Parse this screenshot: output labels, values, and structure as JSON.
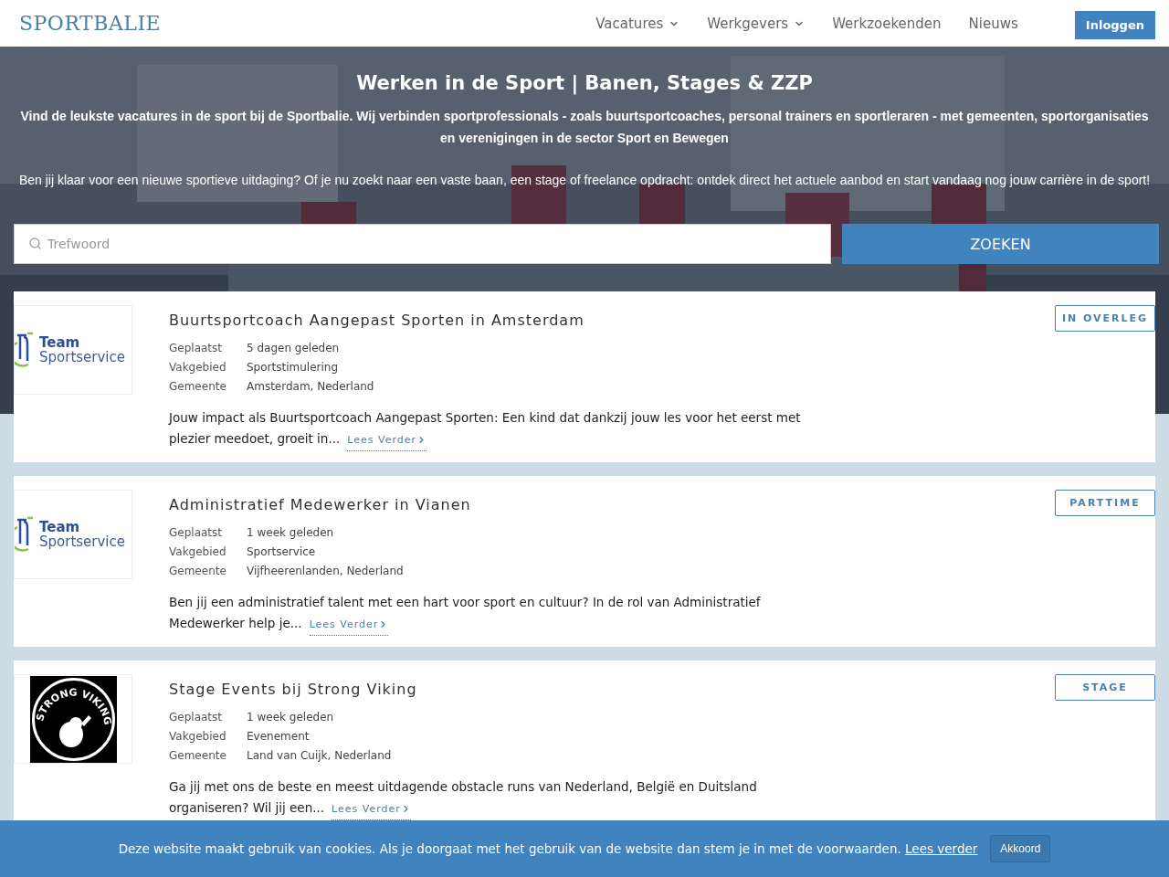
{
  "header": {
    "logo": "SPORTBALIE",
    "nav": [
      {
        "label": "Vacatures",
        "dropdown": true
      },
      {
        "label": "Werkgevers",
        "dropdown": true
      },
      {
        "label": "Werkzoekenden",
        "dropdown": false
      },
      {
        "label": "Nieuws",
        "dropdown": false
      }
    ],
    "login": "Inloggen"
  },
  "hero": {
    "title": "Werken in de Sport | Banen, Stages & ZZP",
    "subtitle": "Vind de leukste vacatures in de sport bij de Sportbalie. Wij verbinden sportprofessionals - zoals buurtsportcoaches, personal trainers en sportleraren - met gemeenten, sportorganisaties en verenigingen in de sector Sport en Bewegen",
    "text": "Ben jij klaar voor een nieuwe sportieve uitdaging? Of je nu zoekt naar een vaste baan, een stage of freelance opdracht: ontdek direct het actuele aanbod en start vandaag nog jouw carrière in de sport!"
  },
  "search": {
    "placeholder": "Trefwoord",
    "button": "ZOEKEN"
  },
  "jobs": [
    {
      "logo": {
        "kind": "team",
        "lines": [
          "Team",
          "Sportservice"
        ]
      },
      "title": "Buurtsportcoach Aangepast Sporten in Amsterdam",
      "details": [
        {
          "label": "Geplaatst",
          "value": "5 dagen geleden"
        },
        {
          "label": "Vakgebied",
          "value": "Sportstimulering"
        },
        {
          "label": "Gemeente",
          "value": "Amsterdam, Nederland"
        }
      ],
      "excerpt": "Jouw impact als Buurtsportcoach Aangepast Sporten: Een kind dat dankzij jouw les voor het eerst met plezier meedoet, groeit in...",
      "more": "Lees Verder",
      "tag": "IN OVERLEG"
    },
    {
      "logo": {
        "kind": "team",
        "lines": [
          "Team",
          "Sportservice"
        ]
      },
      "title": "Administratief Medewerker in Vianen",
      "details": [
        {
          "label": "Geplaatst",
          "value": "1 week geleden"
        },
        {
          "label": "Vakgebied",
          "value": "Sportservice"
        },
        {
          "label": "Gemeente",
          "value": "Vijfheerenlanden, Nederland"
        }
      ],
      "excerpt": "Ben jij een administratief talent met een hart voor sport en cultuur? In de rol van Administratief Medewerker help je...",
      "more": "Lees Verder",
      "tag": "PARTTIME"
    },
    {
      "logo": {
        "kind": "viking",
        "lines": [
          "STRONG VIKING"
        ]
      },
      "title": "Stage Events bij Strong Viking",
      "details": [
        {
          "label": "Geplaatst",
          "value": "1 week geleden"
        },
        {
          "label": "Vakgebied",
          "value": "Evenement"
        },
        {
          "label": "Gemeente",
          "value": "Land van Cuijk, Nederland"
        }
      ],
      "excerpt": "Ga jij met ons de beste en meest uitdagende obstacle runs van Nederland, België en Duitsland organiseren? Wil jij een...",
      "more": "Lees Verder",
      "tag": "STAGE"
    }
  ],
  "cookie": {
    "text": "Deze website maakt gebruik van cookies. Als je doorgaat met het gebruik van de website dan stem je in met de voorwaarden.",
    "link": "Lees verder",
    "button": "Akkoord"
  }
}
